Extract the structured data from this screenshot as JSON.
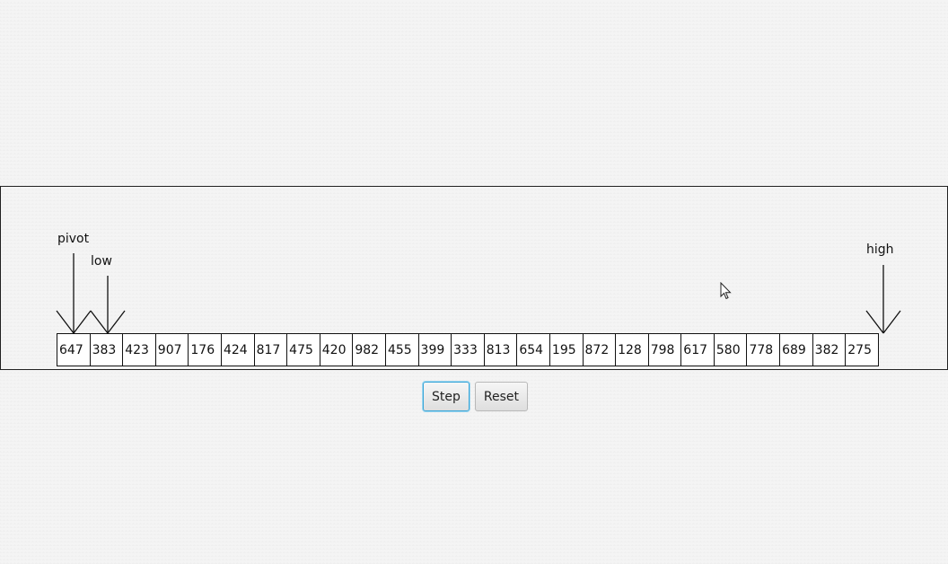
{
  "array": {
    "values": [
      "647",
      "383",
      "423",
      "907",
      "176",
      "424",
      "817",
      "475",
      "420",
      "982",
      "455",
      "399",
      "333",
      "813",
      "654",
      "195",
      "872",
      "128",
      "798",
      "617",
      "580",
      "778",
      "689",
      "382",
      "275"
    ]
  },
  "pointers": {
    "pivot": {
      "label": "pivot",
      "index": 0
    },
    "low": {
      "label": "low",
      "index": 1
    },
    "high": {
      "label": "high",
      "index": 24
    }
  },
  "controls": {
    "step_label": "Step",
    "reset_label": "Reset"
  }
}
